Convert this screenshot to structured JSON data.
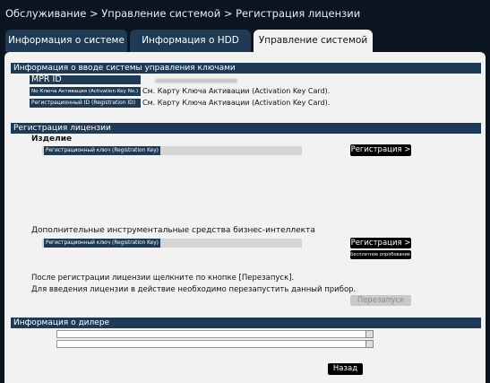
{
  "breadcrumb": "Обслуживание > Управление системой > Регистрация лицензии",
  "tabs": [
    {
      "label": "Информация о системе"
    },
    {
      "label": "Информация о HDD"
    },
    {
      "label": "Управление системой"
    }
  ],
  "key_info": {
    "header": "Информация о вводе системы управления ключами",
    "mpr_label": "MPR ID",
    "activation_label": "No Ключа Активации (Activation Key No.)",
    "activation_value": "См. Карту  Ключа Активации (Activation Key Card).",
    "regid_label": "Регистрационный ID (Registration ID)",
    "regid_value": "См. Карту  Ключа Активации (Activation Key Card)."
  },
  "license_reg": {
    "header": "Регистрация лицензии",
    "product_label": "Изделие",
    "product_key_label": "Регистрационный ключ (Registration Key)",
    "register_button": "Регистрация >",
    "bi_label": "Дополнительные инструментальные средства бизнес-интеллекта",
    "bi_key_label": "Регистрационный ключ (Registration Key)",
    "bi_register_button": "Регистрация >",
    "trial_button": "Бесплатное опробование >",
    "note_line1": "После регистрации лицензии щелкните по кнопке [Перезапуск].",
    "note_line2": "Для введения лицензии в действие необходимо перезапустить данный прибор.",
    "restart_button": "Перезапуск"
  },
  "dealer": {
    "header": "Информация о дилере"
  },
  "back_button": "Назад"
}
